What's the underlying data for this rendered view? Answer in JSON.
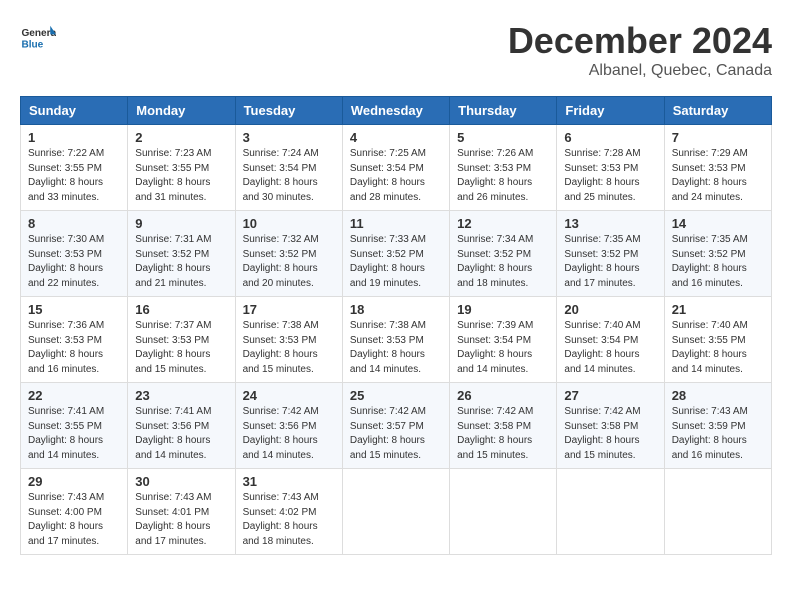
{
  "header": {
    "logo_line1": "General",
    "logo_line2": "Blue",
    "month": "December 2024",
    "location": "Albanel, Quebec, Canada"
  },
  "columns": [
    "Sunday",
    "Monday",
    "Tuesday",
    "Wednesday",
    "Thursday",
    "Friday",
    "Saturday"
  ],
  "weeks": [
    [
      {
        "day": "1",
        "sunrise": "7:22 AM",
        "sunset": "3:55 PM",
        "daylight": "8 hours and 33 minutes."
      },
      {
        "day": "2",
        "sunrise": "7:23 AM",
        "sunset": "3:55 PM",
        "daylight": "8 hours and 31 minutes."
      },
      {
        "day": "3",
        "sunrise": "7:24 AM",
        "sunset": "3:54 PM",
        "daylight": "8 hours and 30 minutes."
      },
      {
        "day": "4",
        "sunrise": "7:25 AM",
        "sunset": "3:54 PM",
        "daylight": "8 hours and 28 minutes."
      },
      {
        "day": "5",
        "sunrise": "7:26 AM",
        "sunset": "3:53 PM",
        "daylight": "8 hours and 26 minutes."
      },
      {
        "day": "6",
        "sunrise": "7:28 AM",
        "sunset": "3:53 PM",
        "daylight": "8 hours and 25 minutes."
      },
      {
        "day": "7",
        "sunrise": "7:29 AM",
        "sunset": "3:53 PM",
        "daylight": "8 hours and 24 minutes."
      }
    ],
    [
      {
        "day": "8",
        "sunrise": "7:30 AM",
        "sunset": "3:53 PM",
        "daylight": "8 hours and 22 minutes."
      },
      {
        "day": "9",
        "sunrise": "7:31 AM",
        "sunset": "3:52 PM",
        "daylight": "8 hours and 21 minutes."
      },
      {
        "day": "10",
        "sunrise": "7:32 AM",
        "sunset": "3:52 PM",
        "daylight": "8 hours and 20 minutes."
      },
      {
        "day": "11",
        "sunrise": "7:33 AM",
        "sunset": "3:52 PM",
        "daylight": "8 hours and 19 minutes."
      },
      {
        "day": "12",
        "sunrise": "7:34 AM",
        "sunset": "3:52 PM",
        "daylight": "8 hours and 18 minutes."
      },
      {
        "day": "13",
        "sunrise": "7:35 AM",
        "sunset": "3:52 PM",
        "daylight": "8 hours and 17 minutes."
      },
      {
        "day": "14",
        "sunrise": "7:35 AM",
        "sunset": "3:52 PM",
        "daylight": "8 hours and 16 minutes."
      }
    ],
    [
      {
        "day": "15",
        "sunrise": "7:36 AM",
        "sunset": "3:53 PM",
        "daylight": "8 hours and 16 minutes."
      },
      {
        "day": "16",
        "sunrise": "7:37 AM",
        "sunset": "3:53 PM",
        "daylight": "8 hours and 15 minutes."
      },
      {
        "day": "17",
        "sunrise": "7:38 AM",
        "sunset": "3:53 PM",
        "daylight": "8 hours and 15 minutes."
      },
      {
        "day": "18",
        "sunrise": "7:38 AM",
        "sunset": "3:53 PM",
        "daylight": "8 hours and 14 minutes."
      },
      {
        "day": "19",
        "sunrise": "7:39 AM",
        "sunset": "3:54 PM",
        "daylight": "8 hours and 14 minutes."
      },
      {
        "day": "20",
        "sunrise": "7:40 AM",
        "sunset": "3:54 PM",
        "daylight": "8 hours and 14 minutes."
      },
      {
        "day": "21",
        "sunrise": "7:40 AM",
        "sunset": "3:55 PM",
        "daylight": "8 hours and 14 minutes."
      }
    ],
    [
      {
        "day": "22",
        "sunrise": "7:41 AM",
        "sunset": "3:55 PM",
        "daylight": "8 hours and 14 minutes."
      },
      {
        "day": "23",
        "sunrise": "7:41 AM",
        "sunset": "3:56 PM",
        "daylight": "8 hours and 14 minutes."
      },
      {
        "day": "24",
        "sunrise": "7:42 AM",
        "sunset": "3:56 PM",
        "daylight": "8 hours and 14 minutes."
      },
      {
        "day": "25",
        "sunrise": "7:42 AM",
        "sunset": "3:57 PM",
        "daylight": "8 hours and 15 minutes."
      },
      {
        "day": "26",
        "sunrise": "7:42 AM",
        "sunset": "3:58 PM",
        "daylight": "8 hours and 15 minutes."
      },
      {
        "day": "27",
        "sunrise": "7:42 AM",
        "sunset": "3:58 PM",
        "daylight": "8 hours and 15 minutes."
      },
      {
        "day": "28",
        "sunrise": "7:43 AM",
        "sunset": "3:59 PM",
        "daylight": "8 hours and 16 minutes."
      }
    ],
    [
      {
        "day": "29",
        "sunrise": "7:43 AM",
        "sunset": "4:00 PM",
        "daylight": "8 hours and 17 minutes."
      },
      {
        "day": "30",
        "sunrise": "7:43 AM",
        "sunset": "4:01 PM",
        "daylight": "8 hours and 17 minutes."
      },
      {
        "day": "31",
        "sunrise": "7:43 AM",
        "sunset": "4:02 PM",
        "daylight": "8 hours and 18 minutes."
      },
      null,
      null,
      null,
      null
    ]
  ],
  "labels": {
    "sunrise": "Sunrise:",
    "sunset": "Sunset:",
    "daylight": "Daylight:"
  }
}
